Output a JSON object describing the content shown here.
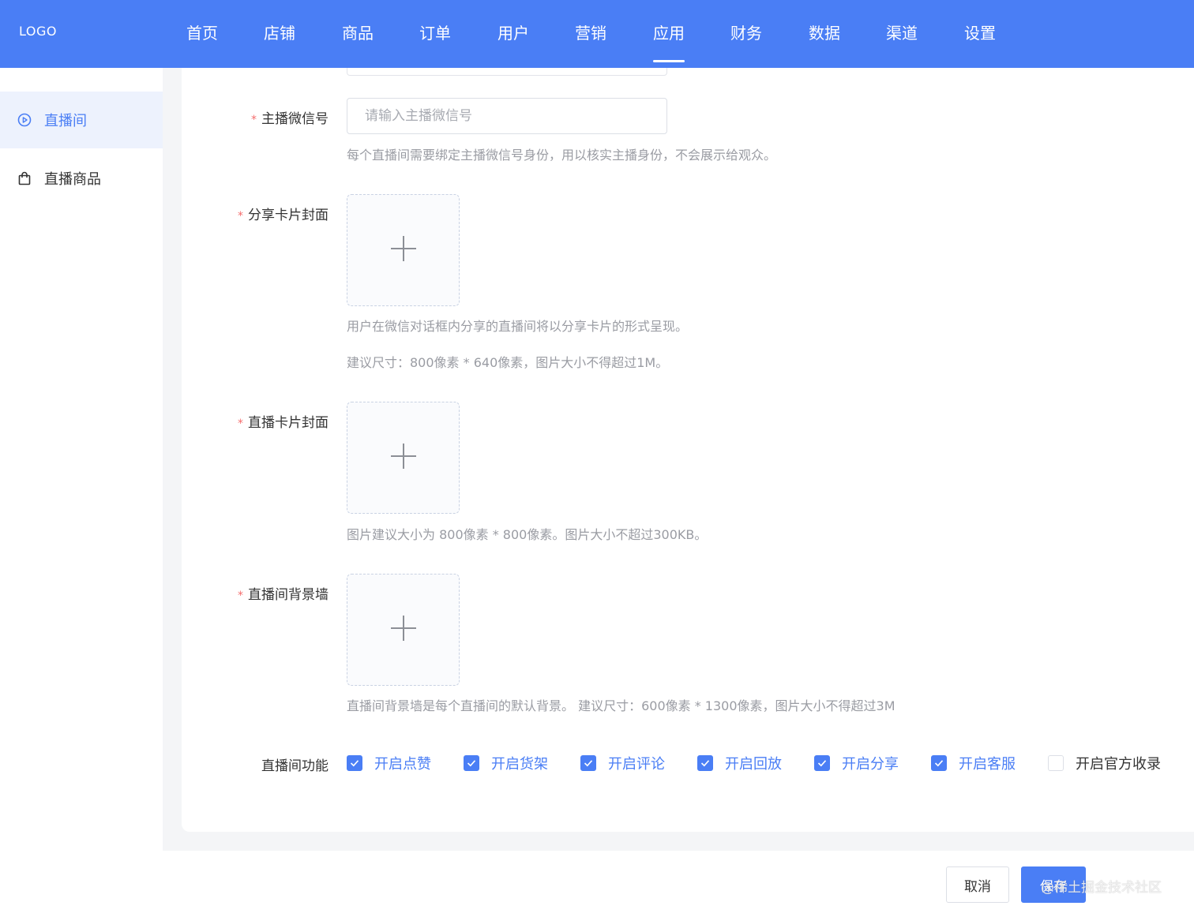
{
  "header": {
    "logo": "LOGO",
    "nav": [
      {
        "label": "首页"
      },
      {
        "label": "店铺"
      },
      {
        "label": "商品"
      },
      {
        "label": "订单"
      },
      {
        "label": "用户"
      },
      {
        "label": "营销"
      },
      {
        "label": "应用",
        "active": true
      },
      {
        "label": "财务"
      },
      {
        "label": "数据"
      },
      {
        "label": "渠道"
      },
      {
        "label": "设置"
      }
    ],
    "accent_color": "#4a7ef5"
  },
  "sidebar": {
    "items": [
      {
        "label": "直播间",
        "icon": "play-circle-icon",
        "active": true
      },
      {
        "label": "直播商品",
        "icon": "shopping-bag-icon"
      }
    ]
  },
  "form": {
    "wechat": {
      "label": "主播微信号",
      "required": true,
      "placeholder": "请输入主播微信号",
      "value": "",
      "help": "每个直播间需要绑定主播微信号身份，用以核实主播身份，不会展示给观众。"
    },
    "share_cover": {
      "label": "分享卡片封面",
      "required": true,
      "help1": "用户在微信对话框内分享的直播间将以分享卡片的形式呈现。",
      "help2": "建议尺寸：800像素 * 640像素，图片大小不得超过1M。"
    },
    "live_cover": {
      "label": "直播卡片封面",
      "required": true,
      "help": "图片建议大小为 800像素 * 800像素。图片大小不超过300KB。"
    },
    "background": {
      "label": "直播间背景墙",
      "required": true,
      "help": "直播间背景墙是每个直播间的默认背景。 建议尺寸：600像素 * 1300像素，图片大小不得超过3M"
    },
    "features": {
      "label": "直播间功能",
      "options": [
        {
          "label": "开启点赞",
          "checked": true
        },
        {
          "label": "开启货架",
          "checked": true
        },
        {
          "label": "开启评论",
          "checked": true
        },
        {
          "label": "开启回放",
          "checked": true
        },
        {
          "label": "开启分享",
          "checked": true
        },
        {
          "label": "开启客服",
          "checked": true
        },
        {
          "label": "开启官方收录",
          "checked": false
        }
      ]
    }
  },
  "footer": {
    "cancel_label": "取消",
    "save_label": "保存",
    "watermark": "@稀土掘金技术社区"
  }
}
